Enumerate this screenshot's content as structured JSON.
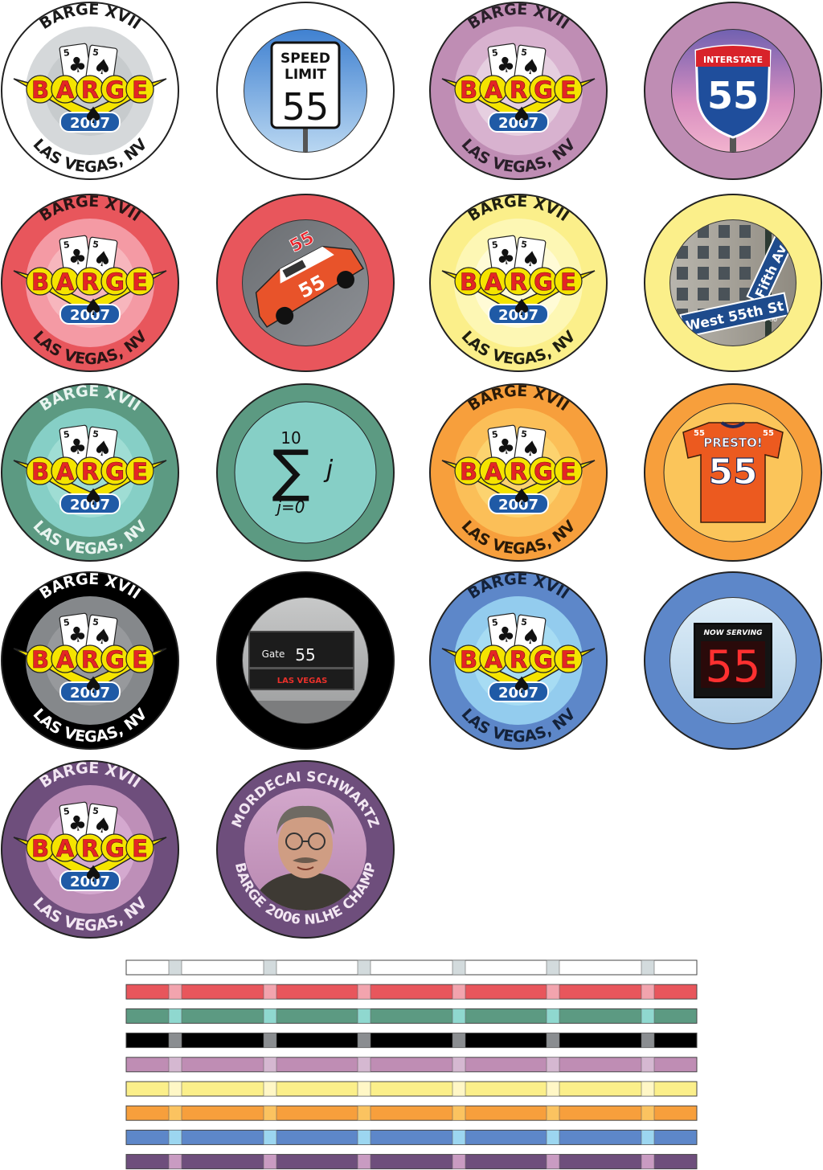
{
  "logo": {
    "top_text": "BARGE XVII",
    "wordmark": "BARGE",
    "year": "2007",
    "bottom_text": "LAS VEGAS, NV",
    "card_rank": "5"
  },
  "colors": {
    "white": {
      "rim": "#ffffff",
      "ring": "#d5d8da",
      "inner": "#c7cbcd",
      "text": "#1a1a1a",
      "insert": "#d3dbdd"
    },
    "purple": {
      "rim": "#bf8db4",
      "ring": "#d8b2cf",
      "inner": "#e6cfe0",
      "text": "#2a1f2a",
      "insert": "#d5b8d1"
    },
    "red": {
      "rim": "#e8565c",
      "ring": "#f49aa4",
      "inner": "#f7b6bd",
      "text": "#2a1515",
      "insert": "#f2a4ae"
    },
    "yellow": {
      "rim": "#fbef8a",
      "ring": "#fdf7b4",
      "inner": "#fffbd6",
      "text": "#1f1f10",
      "insert": "#fff7c6"
    },
    "green": {
      "rim": "#5c9a82",
      "ring": "#86cfc6",
      "inner": "#9fddd4",
      "text": "#e8f4ef",
      "insert": "#8fd8cf"
    },
    "orange": {
      "rim": "#f79f3c",
      "ring": "#fbbf58",
      "inner": "#fcd36f",
      "text": "#2a1a08",
      "insert": "#fbc360"
    },
    "black": {
      "rim": "#000000",
      "ring": "#85888b",
      "inner": "#97999c",
      "text": "#ffffff",
      "insert": "#8a8d90"
    },
    "blue": {
      "rim": "#5d87c9",
      "ring": "#93ccee",
      "inner": "#a7dcf3",
      "text": "#14223a",
      "insert": "#9cd6f0"
    },
    "plum": {
      "rim": "#6e4e7c",
      "ring": "#be8fb8",
      "inner": "#d4a9cf",
      "text": "#f2e6f2",
      "insert": "#c99bc2"
    },
    "logo_red": "#e52525",
    "logo_yellow": "#f5e400",
    "logo_blue": "#1f5aa6"
  },
  "chips": {
    "speed_limit": {
      "line1": "SPEED",
      "line2": "LIMIT",
      "number": "55"
    },
    "interstate": {
      "label": "INTERSTATE",
      "number": "55"
    },
    "race_car": {
      "number": "55"
    },
    "street_sign": {
      "ave": "Fifth Ave",
      "block": "2-60",
      "street": "West 55th St"
    },
    "summation": {
      "upper": "10",
      "operand": "j",
      "lower": "j=0"
    },
    "jersey": {
      "name": "PRESTO!",
      "number": "55",
      "back_tag": "55"
    },
    "airport_gate": {
      "gate_label": "Gate",
      "gate_number": "55",
      "destination": "LAS VEGAS"
    },
    "now_serving": {
      "title": "NOW SERVING",
      "number": "55"
    },
    "champion": {
      "name": "MORDECAI SCHWARTZ",
      "title": "BARGE 2006 NLHE CHAMP"
    }
  },
  "stripe_colors": [
    "white",
    "red",
    "green",
    "black",
    "purple",
    "yellow",
    "orange",
    "blue",
    "plum"
  ]
}
